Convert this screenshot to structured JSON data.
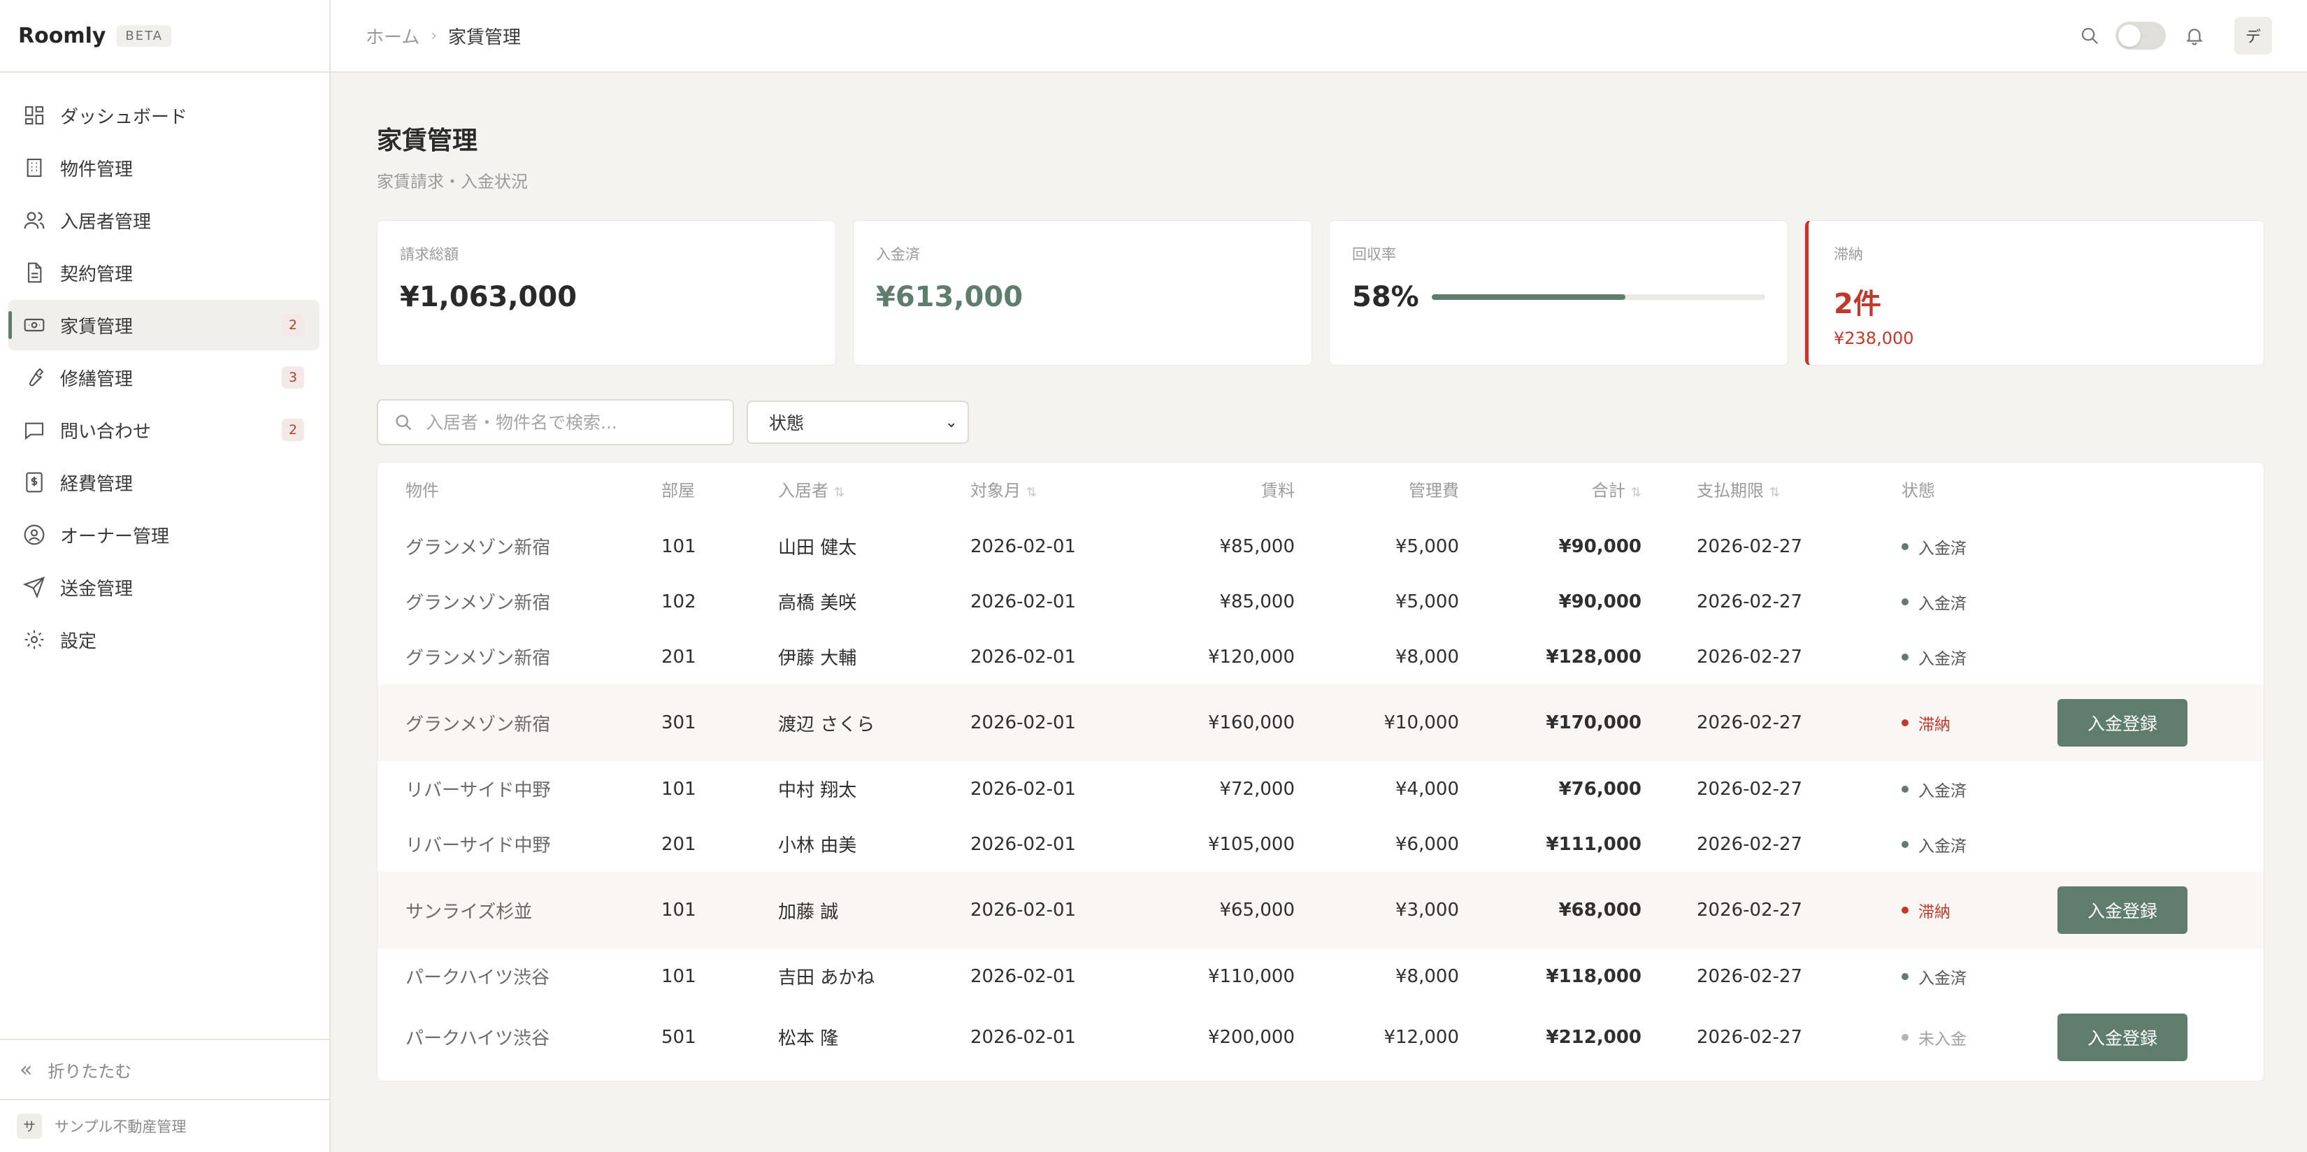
{
  "brand": {
    "name": "Roomly",
    "badge": "BETA"
  },
  "sidebar": {
    "items": [
      {
        "label": "ダッシュボード",
        "icon": "dashboard-icon",
        "badge": ""
      },
      {
        "label": "物件管理",
        "icon": "building-icon",
        "badge": ""
      },
      {
        "label": "入居者管理",
        "icon": "users-icon",
        "badge": ""
      },
      {
        "label": "契約管理",
        "icon": "document-icon",
        "badge": ""
      },
      {
        "label": "家賃管理",
        "icon": "banknote-icon",
        "badge": "2",
        "active": true
      },
      {
        "label": "修繕管理",
        "icon": "wrench-icon",
        "badge": "3"
      },
      {
        "label": "問い合わせ",
        "icon": "message-icon",
        "badge": "2"
      },
      {
        "label": "経費管理",
        "icon": "dollar-receipt-icon",
        "badge": ""
      },
      {
        "label": "オーナー管理",
        "icon": "user-circle-icon",
        "badge": ""
      },
      {
        "label": "送金管理",
        "icon": "send-icon",
        "badge": ""
      },
      {
        "label": "設定",
        "icon": "gear-icon",
        "badge": ""
      }
    ],
    "collapse_label": "折りたたむ",
    "org_initial": "サ",
    "org_name": "サンプル不動産管理"
  },
  "header": {
    "breadcrumb_home": "ホーム",
    "breadcrumb_current": "家賃管理",
    "user_initial": "デ"
  },
  "page": {
    "title": "家賃管理",
    "subtitle": "家賃請求・入金状況"
  },
  "stats": {
    "billed": {
      "label": "請求総額",
      "value": "¥1,063,000"
    },
    "paid": {
      "label": "入金済",
      "value": "¥613,000"
    },
    "rate": {
      "label": "回収率",
      "value": "58%",
      "fraction": 0.58
    },
    "overdue": {
      "label": "滞納",
      "value": "2件",
      "amount": "¥238,000"
    }
  },
  "filters": {
    "search_placeholder": "入居者・物件名で検索...",
    "status_select": "状態"
  },
  "colors": {
    "accent": "#5e7d6d",
    "danger": "#c0392b",
    "unpaid": "#b3b3b3"
  },
  "table": {
    "headers": {
      "property": "物件",
      "room": "部屋",
      "tenant": "入居者",
      "month": "対象月",
      "rent": "賃料",
      "fee": "管理費",
      "total": "合計",
      "due": "支払期限",
      "status": "状態"
    },
    "action_label": "入金登録",
    "rows": [
      {
        "property": "グランメゾン新宿",
        "room": "101",
        "tenant": "山田 健太",
        "month": "2026-02-01",
        "rent": "¥85,000",
        "fee": "¥5,000",
        "total": "¥90,000",
        "due": "2026-02-27",
        "status": "入金済",
        "state": "paid"
      },
      {
        "property": "グランメゾン新宿",
        "room": "102",
        "tenant": "高橋 美咲",
        "month": "2026-02-01",
        "rent": "¥85,000",
        "fee": "¥5,000",
        "total": "¥90,000",
        "due": "2026-02-27",
        "status": "入金済",
        "state": "paid"
      },
      {
        "property": "グランメゾン新宿",
        "room": "201",
        "tenant": "伊藤 大輔",
        "month": "2026-02-01",
        "rent": "¥120,000",
        "fee": "¥8,000",
        "total": "¥128,000",
        "due": "2026-02-27",
        "status": "入金済",
        "state": "paid"
      },
      {
        "property": "グランメゾン新宿",
        "room": "301",
        "tenant": "渡辺 さくら",
        "month": "2026-02-01",
        "rent": "¥160,000",
        "fee": "¥10,000",
        "total": "¥170,000",
        "due": "2026-02-27",
        "status": "滞納",
        "state": "overdue"
      },
      {
        "property": "リバーサイド中野",
        "room": "101",
        "tenant": "中村 翔太",
        "month": "2026-02-01",
        "rent": "¥72,000",
        "fee": "¥4,000",
        "total": "¥76,000",
        "due": "2026-02-27",
        "status": "入金済",
        "state": "paid"
      },
      {
        "property": "リバーサイド中野",
        "room": "201",
        "tenant": "小林 由美",
        "month": "2026-02-01",
        "rent": "¥105,000",
        "fee": "¥6,000",
        "total": "¥111,000",
        "due": "2026-02-27",
        "status": "入金済",
        "state": "paid"
      },
      {
        "property": "サンライズ杉並",
        "room": "101",
        "tenant": "加藤 誠",
        "month": "2026-02-01",
        "rent": "¥65,000",
        "fee": "¥3,000",
        "total": "¥68,000",
        "due": "2026-02-27",
        "status": "滞納",
        "state": "overdue"
      },
      {
        "property": "パークハイツ渋谷",
        "room": "101",
        "tenant": "吉田 あかね",
        "month": "2026-02-01",
        "rent": "¥110,000",
        "fee": "¥8,000",
        "total": "¥118,000",
        "due": "2026-02-27",
        "status": "入金済",
        "state": "paid"
      },
      {
        "property": "パークハイツ渋谷",
        "room": "501",
        "tenant": "松本 隆",
        "month": "2026-02-01",
        "rent": "¥200,000",
        "fee": "¥12,000",
        "total": "¥212,000",
        "due": "2026-02-27",
        "status": "未入金",
        "state": "unpaid"
      }
    ]
  }
}
